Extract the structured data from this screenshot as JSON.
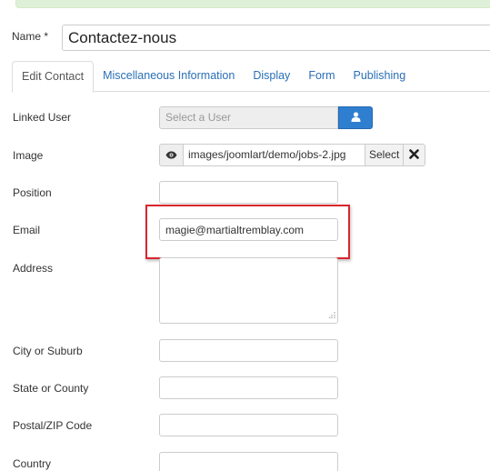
{
  "name_field": {
    "label": "Name *",
    "value": "Contactez-nous"
  },
  "tabs": [
    {
      "label": "Edit Contact",
      "active": true
    },
    {
      "label": "Miscellaneous Information",
      "active": false
    },
    {
      "label": "Display",
      "active": false
    },
    {
      "label": "Form",
      "active": false
    },
    {
      "label": "Publishing",
      "active": false
    }
  ],
  "fields": {
    "linked_user": {
      "label": "Linked User",
      "placeholder": "Select a User",
      "button_icon": "user-icon"
    },
    "image": {
      "label": "Image",
      "value": "images/joomlart/demo/jobs-2.jpg",
      "preview_icon": "eye-icon",
      "select_label": "Select",
      "clear_icon": "close-icon"
    },
    "position": {
      "label": "Position",
      "value": ""
    },
    "email": {
      "label": "Email",
      "value": "magie@martialtremblay.com"
    },
    "address": {
      "label": "Address",
      "value": ""
    },
    "city": {
      "label": "City or Suburb",
      "value": ""
    },
    "state": {
      "label": "State or County",
      "value": ""
    },
    "postal": {
      "label": "Postal/ZIP Code",
      "value": ""
    },
    "country": {
      "label": "Country",
      "value": ""
    }
  },
  "colors": {
    "accent_blue": "#2f7fd1",
    "link_blue": "#2a6fb5",
    "highlight_red": "#d9262c",
    "success_green": "#dff0d8"
  }
}
